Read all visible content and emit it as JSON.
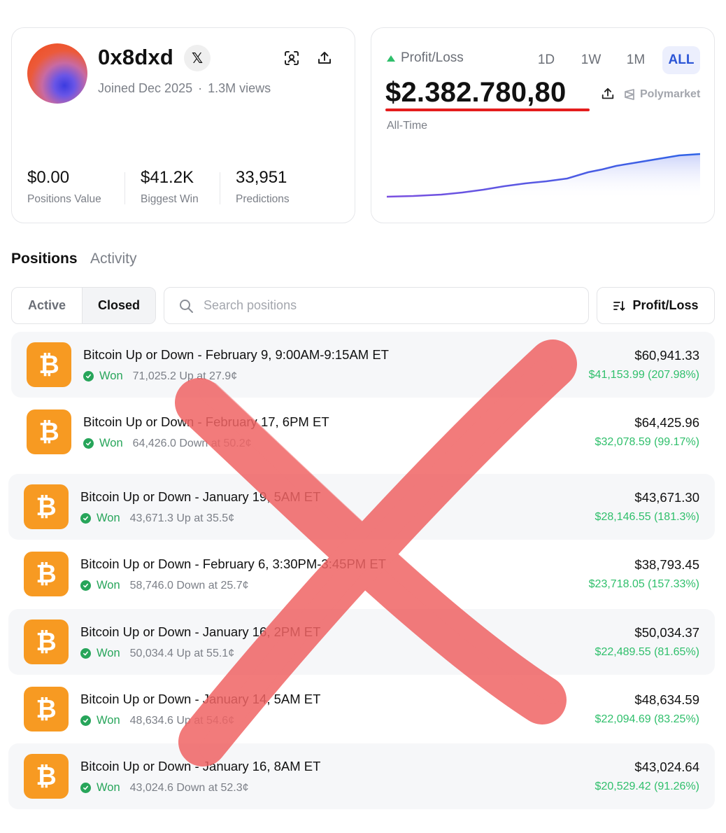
{
  "profile": {
    "username": "0x8dxd",
    "x_badge": "𝕏",
    "joined": "Joined Dec 2025",
    "separator": "·",
    "views": "1.3M views",
    "stats": [
      {
        "value": "$0.00",
        "label": "Positions Value"
      },
      {
        "value": "$41.2K",
        "label": "Biggest Win"
      },
      {
        "value": "33,951",
        "label": "Predictions"
      }
    ]
  },
  "pnl": {
    "label": "Profit/Loss",
    "ranges": [
      "1D",
      "1W",
      "1M",
      "ALL"
    ],
    "active_range": "ALL",
    "value": "$2.382.780,80",
    "brand": "Polymarket",
    "period": "All-Time",
    "trend": "rising",
    "colors": {
      "up": "#2fbf6b",
      "underline": "#e41d1d",
      "line_start": "#7b4fe0",
      "line_end": "#2e63e6"
    }
  },
  "tabs": {
    "positions": "Positions",
    "activity": "Activity",
    "active": "Positions"
  },
  "filter": {
    "active_label": "Active",
    "closed_label": "Closed",
    "selected": "Closed"
  },
  "search": {
    "placeholder": "Search positions",
    "value": ""
  },
  "sort": {
    "label": "Profit/Loss"
  },
  "positions": [
    {
      "title": "Bitcoin Up or Down - February 9, 9:00AM-9:15AM ET",
      "status": "Won",
      "detail": "71,025.2 Up at 27.9¢",
      "value": "$60,941.33",
      "pnl": "$41,153.99 (207.98%)"
    },
    {
      "title": "Bitcoin Up or Down - February 17, 6PM ET",
      "status": "Won",
      "detail": "64,426.0 Down at 50.2¢",
      "value": "$64,425.96",
      "pnl": "$32,078.59 (99.17%)"
    },
    {
      "title": "Bitcoin Up or Down - January 19, 5AM ET",
      "status": "Won",
      "detail": "43,671.3 Up at 35.5¢",
      "value": "$43,671.30",
      "pnl": "$28,146.55 (181.3%)"
    },
    {
      "title": "Bitcoin Up or Down - February 6, 3:30PM-3:45PM ET",
      "status": "Won",
      "detail": "58,746.0 Down at 25.7¢",
      "value": "$38,793.45",
      "pnl": "$23,718.05 (157.33%)"
    },
    {
      "title": "Bitcoin Up or Down - January 16, 2PM ET",
      "status": "Won",
      "detail": "50,034.4 Up at 55.1¢",
      "value": "$50,034.37",
      "pnl": "$22,489.55 (81.65%)"
    },
    {
      "title": "Bitcoin Up or Down - January 14, 5AM ET",
      "status": "Won",
      "detail": "48,634.6 Up at 54.6¢",
      "value": "$48,634.59",
      "pnl": "$22,094.69 (83.25%)"
    },
    {
      "title": "Bitcoin Up or Down - January 16, 8AM ET",
      "status": "Won",
      "detail": "43,024.6 Down at 52.3¢",
      "value": "$43,024.64",
      "pnl": "$20,529.42 (91.26%)"
    }
  ],
  "coin_symbol": "₿",
  "overlay": {
    "icon": "red-x-cross-icon",
    "color": "#f06464"
  }
}
